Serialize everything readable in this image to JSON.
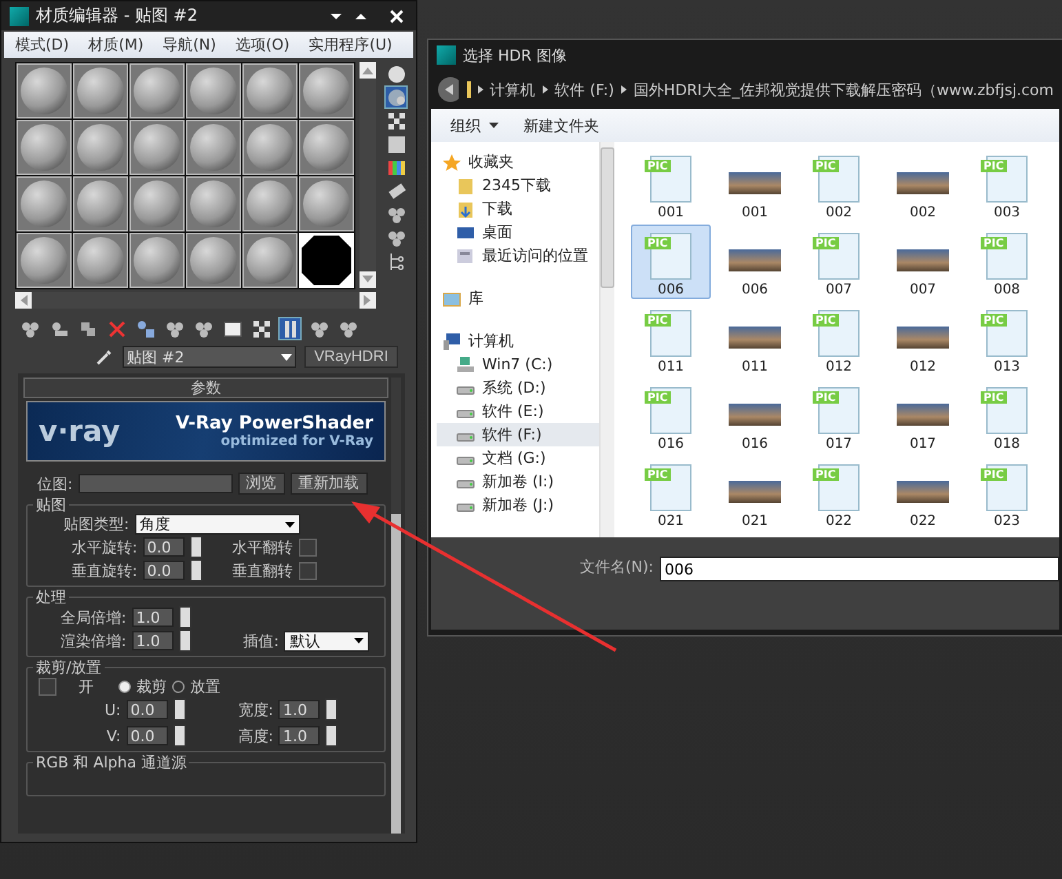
{
  "material_editor": {
    "title": "材质编辑器 - 贴图 #2",
    "menu": [
      "模式(D)",
      "材质(M)",
      "导航(N)",
      "选项(O)",
      "实用程序(U)"
    ],
    "samples": [
      {
        "kind": "sphere",
        "selected": false
      },
      {
        "kind": "sphere",
        "selected": false
      },
      {
        "kind": "sphere",
        "selected": false
      },
      {
        "kind": "sphere",
        "selected": false
      },
      {
        "kind": "sphere",
        "selected": false
      },
      {
        "kind": "sphere",
        "selected": false
      },
      {
        "kind": "sphere",
        "selected": false
      },
      {
        "kind": "sphere",
        "selected": false
      },
      {
        "kind": "sphere",
        "selected": false
      },
      {
        "kind": "sphere",
        "selected": false
      },
      {
        "kind": "sphere",
        "selected": false
      },
      {
        "kind": "sphere",
        "selected": false
      },
      {
        "kind": "sphere",
        "selected": false
      },
      {
        "kind": "sphere",
        "selected": false
      },
      {
        "kind": "sphere",
        "selected": false
      },
      {
        "kind": "sphere",
        "selected": false
      },
      {
        "kind": "sphere",
        "selected": false
      },
      {
        "kind": "sphere",
        "selected": false
      },
      {
        "kind": "sphere",
        "selected": false
      },
      {
        "kind": "sphere",
        "selected": false
      },
      {
        "kind": "sphere",
        "selected": false
      },
      {
        "kind": "sphere",
        "selected": false
      },
      {
        "kind": "sphere",
        "selected": false
      },
      {
        "kind": "black",
        "selected": true
      }
    ],
    "side_tools": [
      {
        "kind": "sphere",
        "active": false
      },
      {
        "kind": "backlight",
        "active": true
      },
      {
        "kind": "checker",
        "active": false
      },
      {
        "kind": "square",
        "active": false
      },
      {
        "kind": "colors",
        "active": false
      },
      {
        "kind": "tag",
        "active": false
      },
      {
        "kind": "balls",
        "active": false
      },
      {
        "kind": "balls",
        "active": false
      },
      {
        "kind": "tree",
        "active": false
      }
    ],
    "bottom_tools": [
      {
        "kind": "balls",
        "active": false
      },
      {
        "kind": "put",
        "active": false
      },
      {
        "kind": "assign",
        "active": false
      },
      {
        "kind": "delete",
        "active": false
      },
      {
        "kind": "copy",
        "active": false
      },
      {
        "kind": "balls",
        "active": false
      },
      {
        "kind": "balls",
        "active": false
      },
      {
        "kind": "id",
        "active": false
      },
      {
        "kind": "checker",
        "active": false
      },
      {
        "kind": "map",
        "active": true
      },
      {
        "kind": "balls",
        "active": false
      },
      {
        "kind": "balls",
        "active": false
      }
    ],
    "map_name": "贴图 #2",
    "map_type": "VRayHDRI",
    "rollout_title": "参数",
    "banner": {
      "logo": "v·ray",
      "title": "V-Ray PowerShader",
      "subtitle": "optimized for V-Ray"
    },
    "bitmap": {
      "label": "位图:",
      "buttons": [
        "浏览",
        "重新加载"
      ]
    },
    "mapping": {
      "title": "贴图",
      "type_label": "贴图类型:",
      "type_value": "角度",
      "rows": [
        {
          "label": "水平旋转:",
          "value": "0.0",
          "flip_label": "水平翻转",
          "flip_checked": false
        },
        {
          "label": "垂直旋转:",
          "value": "0.0",
          "flip_label": "垂直翻转",
          "flip_checked": false
        }
      ]
    },
    "processing": {
      "title": "处理",
      "rows": [
        {
          "label": "全局倍增:",
          "value": "1.0"
        },
        {
          "label": "渲染倍增:",
          "value": "1.0"
        }
      ],
      "interp_label": "插值:",
      "interp_value": "默认"
    },
    "crop": {
      "title": "裁剪/放置",
      "on_label": "开",
      "on_checked": false,
      "modes": [
        {
          "label": "裁剪",
          "selected": true
        },
        {
          "label": "放置",
          "selected": false
        }
      ],
      "fields": [
        {
          "label": "U:",
          "value": "0.0"
        },
        {
          "label": "宽度:",
          "value": "1.0"
        },
        {
          "label": "V:",
          "value": "0.0"
        },
        {
          "label": "高度:",
          "value": "1.0"
        }
      ]
    },
    "channels_title": "RGB 和 Alpha 通道源"
  },
  "file_dialog": {
    "title": "选择 HDR 图像",
    "path": [
      "计算机",
      "软件 (F:)",
      "国外HDRI大全_佐邦视觉提供下载解压密码（www.zbfjsj.com"
    ],
    "toolbar": [
      {
        "label": "组织",
        "menu": true
      },
      {
        "label": "新建文件夹",
        "menu": false
      }
    ],
    "nav": [
      {
        "label": "收藏夹",
        "kind": "star",
        "selected": false,
        "children": [
          {
            "label": "2345下载",
            "kind": "folder",
            "selected": false
          },
          {
            "label": "下载",
            "kind": "download",
            "selected": false
          },
          {
            "label": "桌面",
            "kind": "desktop",
            "selected": false
          },
          {
            "label": "最近访问的位置",
            "kind": "recent",
            "selected": false
          }
        ]
      },
      {
        "label": "库",
        "kind": "library",
        "selected": false
      },
      {
        "label": "计算机",
        "kind": "computer",
        "selected": false,
        "children": [
          {
            "label": "Win7 (C:)",
            "kind": "system-drive",
            "selected": false
          },
          {
            "label": "系统 (D:)",
            "kind": "drive",
            "selected": false
          },
          {
            "label": "软件 (E:)",
            "kind": "drive",
            "selected": false
          },
          {
            "label": "软件 (F:)",
            "kind": "drive",
            "selected": true
          },
          {
            "label": "文档 (G:)",
            "kind": "drive",
            "selected": false
          },
          {
            "label": "新加卷 (I:)",
            "kind": "drive",
            "selected": false
          },
          {
            "label": "新加卷 (J:)",
            "kind": "drive",
            "selected": false
          }
        ]
      }
    ],
    "files": [
      {
        "name": "001",
        "kind": "pic",
        "badge": "PIC",
        "selected": false
      },
      {
        "name": "001",
        "kind": "photo",
        "selected": false
      },
      {
        "name": "002",
        "kind": "pic",
        "badge": "PIC",
        "selected": false
      },
      {
        "name": "002",
        "kind": "photo",
        "selected": false
      },
      {
        "name": "003",
        "kind": "pic",
        "badge": "PIC",
        "selected": false
      },
      {
        "name": "006",
        "kind": "pic",
        "badge": "PIC",
        "selected": true
      },
      {
        "name": "006",
        "kind": "photo",
        "selected": false
      },
      {
        "name": "007",
        "kind": "pic",
        "badge": "PIC",
        "selected": false
      },
      {
        "name": "007",
        "kind": "photo",
        "selected": false
      },
      {
        "name": "008",
        "kind": "pic",
        "badge": "PIC",
        "selected": false
      },
      {
        "name": "011",
        "kind": "pic",
        "badge": "PIC",
        "selected": false
      },
      {
        "name": "011",
        "kind": "photo",
        "selected": false
      },
      {
        "name": "012",
        "kind": "pic",
        "badge": "PIC",
        "selected": false
      },
      {
        "name": "012",
        "kind": "photo",
        "selected": false
      },
      {
        "name": "013",
        "kind": "pic",
        "badge": "PIC",
        "selected": false
      },
      {
        "name": "016",
        "kind": "pic",
        "badge": "PIC",
        "selected": false
      },
      {
        "name": "016",
        "kind": "photo",
        "selected": false
      },
      {
        "name": "017",
        "kind": "pic",
        "badge": "PIC",
        "selected": false
      },
      {
        "name": "017",
        "kind": "photo",
        "selected": false
      },
      {
        "name": "018",
        "kind": "pic",
        "badge": "PIC",
        "selected": false
      },
      {
        "name": "021",
        "kind": "pic",
        "badge": "PIC",
        "selected": false
      },
      {
        "name": "021",
        "kind": "photo",
        "selected": false
      },
      {
        "name": "022",
        "kind": "pic",
        "badge": "PIC",
        "selected": false
      },
      {
        "name": "022",
        "kind": "photo",
        "selected": false
      },
      {
        "name": "023",
        "kind": "pic",
        "badge": "PIC",
        "selected": false
      }
    ],
    "filename_label": "文件名(N):",
    "filename_value": "006"
  }
}
